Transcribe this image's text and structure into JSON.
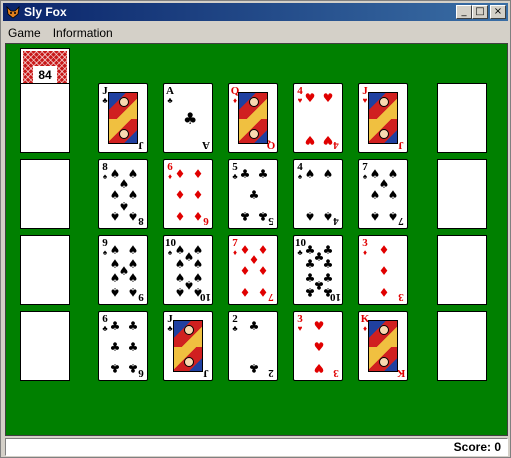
{
  "window": {
    "title": "Sly Fox"
  },
  "titlebar_buttons": {
    "minimize": "_",
    "maximize": "□",
    "close": "×"
  },
  "menu": {
    "items": [
      "Game",
      "Information"
    ]
  },
  "stock": {
    "count": "84"
  },
  "status": {
    "score_label": "Score: 0"
  },
  "cards": [
    {
      "row": 0,
      "col": 1,
      "rank": "J",
      "suit": "♣",
      "color": "black",
      "face": true
    },
    {
      "row": 0,
      "col": 2,
      "rank": "A",
      "suit": "♣",
      "color": "black",
      "face": false
    },
    {
      "row": 0,
      "col": 3,
      "rank": "Q",
      "suit": "♦",
      "color": "red",
      "face": true
    },
    {
      "row": 0,
      "col": 4,
      "rank": "4",
      "suit": "♥",
      "color": "red",
      "face": false
    },
    {
      "row": 0,
      "col": 5,
      "rank": "J",
      "suit": "♥",
      "color": "red",
      "face": true
    },
    {
      "row": 1,
      "col": 1,
      "rank": "8",
      "suit": "♠",
      "color": "black",
      "face": false
    },
    {
      "row": 1,
      "col": 2,
      "rank": "6",
      "suit": "♦",
      "color": "red",
      "face": false
    },
    {
      "row": 1,
      "col": 3,
      "rank": "5",
      "suit": "♣",
      "color": "black",
      "face": false
    },
    {
      "row": 1,
      "col": 4,
      "rank": "4",
      "suit": "♠",
      "color": "black",
      "face": false
    },
    {
      "row": 1,
      "col": 5,
      "rank": "7",
      "suit": "♠",
      "color": "black",
      "face": false
    },
    {
      "row": 2,
      "col": 1,
      "rank": "9",
      "suit": "♠",
      "color": "black",
      "face": false
    },
    {
      "row": 2,
      "col": 2,
      "rank": "10",
      "suit": "♠",
      "color": "black",
      "face": false
    },
    {
      "row": 2,
      "col": 3,
      "rank": "7",
      "suit": "♦",
      "color": "red",
      "face": false
    },
    {
      "row": 2,
      "col": 4,
      "rank": "10",
      "suit": "♣",
      "color": "black",
      "face": false
    },
    {
      "row": 2,
      "col": 5,
      "rank": "3",
      "suit": "♦",
      "color": "red",
      "face": false
    },
    {
      "row": 3,
      "col": 1,
      "rank": "6",
      "suit": "♣",
      "color": "black",
      "face": false
    },
    {
      "row": 3,
      "col": 2,
      "rank": "J",
      "suit": "♣",
      "color": "black",
      "face": true
    },
    {
      "row": 3,
      "col": 3,
      "rank": "2",
      "suit": "♣",
      "color": "black",
      "face": false
    },
    {
      "row": 3,
      "col": 4,
      "rank": "3",
      "suit": "♥",
      "color": "red",
      "face": false
    },
    {
      "row": 3,
      "col": 5,
      "rank": "K",
      "suit": "♦",
      "color": "red",
      "face": true
    }
  ],
  "empty_slots": [
    {
      "row": 0,
      "col": 0
    },
    {
      "row": 1,
      "col": 0
    },
    {
      "row": 2,
      "col": 0
    },
    {
      "row": 3,
      "col": 0
    },
    {
      "row": 0,
      "col": 6
    },
    {
      "row": 1,
      "col": 6
    },
    {
      "row": 2,
      "col": 6
    },
    {
      "row": 3,
      "col": 6
    }
  ]
}
